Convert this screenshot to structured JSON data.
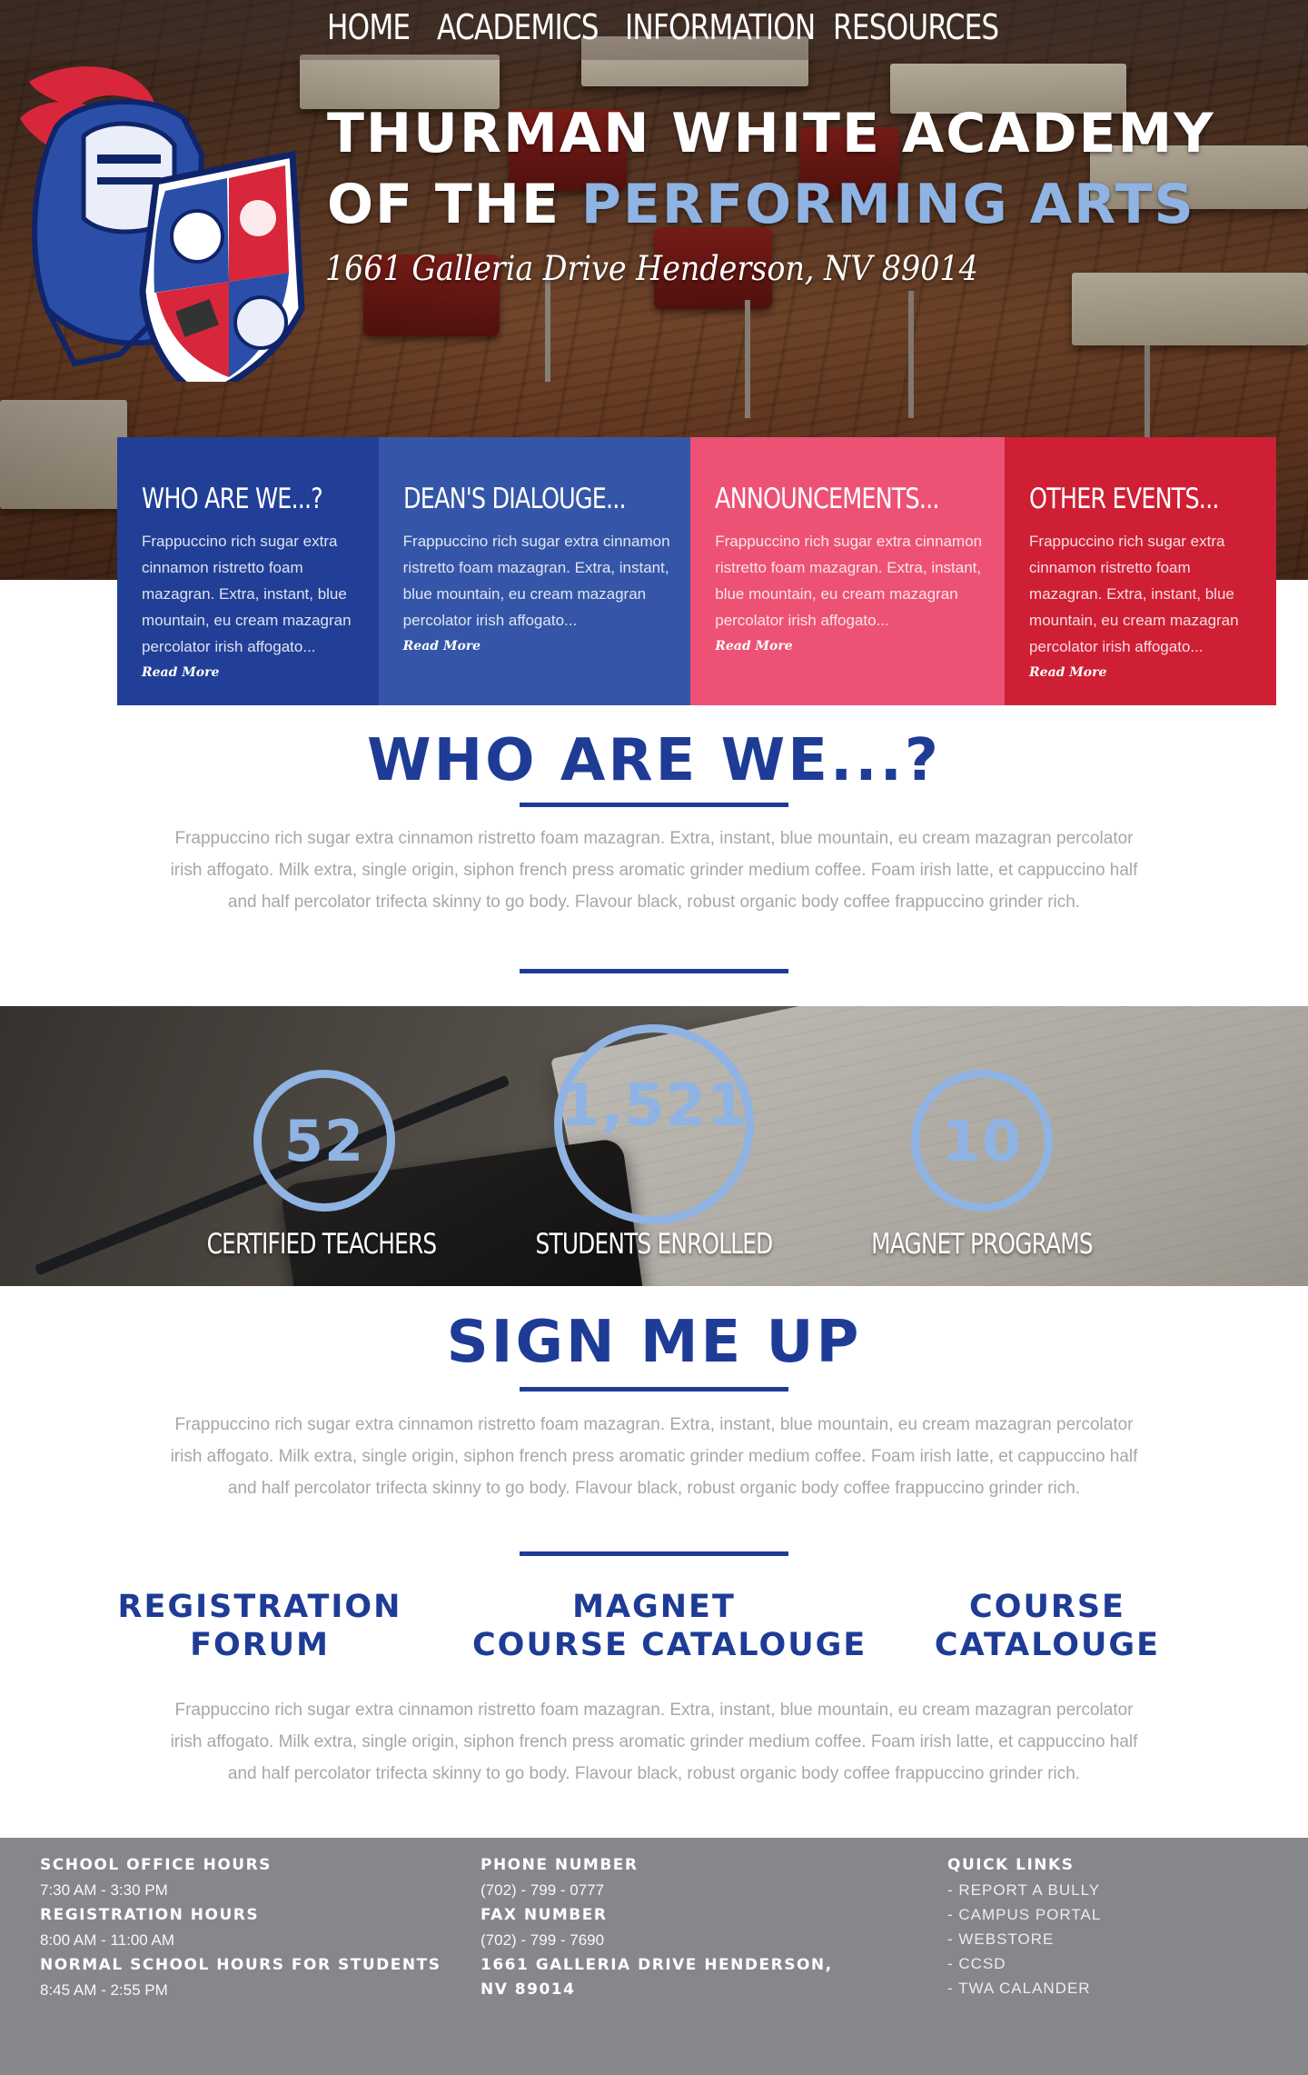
{
  "nav": {
    "items": [
      "HOME",
      "ACADEMICS",
      "INFORMATION",
      "RESOURCES"
    ]
  },
  "hero": {
    "title_line1": "THURMAN WHITE ACADEMY",
    "title_line2_prefix": "OF THE ",
    "title_line2_accent": "PERFORMING ARTS",
    "address": "1661 Galleria Drive  Henderson, NV 89014"
  },
  "features": [
    {
      "title": "WHO ARE WE...?",
      "text": "Frappuccino rich sugar extra cinnamon ristretto foam mazagran. Extra, instant, blue mountain, eu cream mazagran percolator irish affogato...",
      "more": "Read More",
      "color": "#213f97"
    },
    {
      "title": "DEAN'S DIALOUGE...",
      "text": "Frappuccino rich sugar extra cinnamon ristretto foam mazagran. Extra, instant, blue mountain, eu cream mazagran percolator irish affogato...",
      "more": "Read More",
      "color": "#3556a8"
    },
    {
      "title": "ANNOUNCEMENTS...",
      "text": "Frappuccino rich sugar extra cinnamon ristretto foam mazagran. Extra, instant, blue mountain, eu cream mazagran percolator irish affogato...",
      "more": "Read More",
      "color": "#ed5274"
    },
    {
      "title": "OTHER EVENTS...",
      "text": "Frappuccino rich sugar extra cinnamon ristretto foam mazagran. Extra, instant, blue mountain, eu cream mazagran percolator irish affogato...",
      "more": "Read More",
      "color": "#cf1f35"
    }
  ],
  "who": {
    "title": "WHO ARE WE...?",
    "text": "Frappuccino rich sugar extra cinnamon ristretto foam mazagran. Extra, instant, blue mountain, eu cream mazagran percolator irish affogato. Milk extra, single origin, siphon french press aromatic grinder medium coffee. Foam irish latte, et cappuccino half and half percolator trifecta skinny to go body. Flavour black, robust organic body coffee frappuccino grinder rich."
  },
  "stats": [
    {
      "number": "52",
      "label": "CERTIFIED TEACHERS"
    },
    {
      "number": "1,521",
      "label": "STUDENTS ENROLLED"
    },
    {
      "number": "10",
      "label": "MAGNET PROGRAMS"
    }
  ],
  "signup": {
    "title": "SIGN ME UP",
    "text": "Frappuccino rich sugar extra cinnamon ristretto foam mazagran. Extra, instant, blue mountain, eu cream mazagran percolator irish affogato. Milk extra, single origin, siphon french press aromatic grinder medium coffee. Foam irish latte, et cappuccino half and half percolator trifecta skinny to go body. Flavour black, robust organic body coffee frappuccino grinder rich.",
    "links": [
      {
        "line1": "REGISTRATION",
        "line2": "FORUM"
      },
      {
        "line1": "MAGNET",
        "line2": "COURSE CATALOUGE"
      },
      {
        "line1": "COURSE",
        "line2": "CATALOUGE"
      }
    ],
    "text2": "Frappuccino rich sugar extra cinnamon ristretto foam mazagran. Extra, instant, blue mountain, eu cream mazagran percolator irish affogato. Milk extra, single origin, siphon french press aromatic grinder medium coffee. Foam irish latte, et cappuccino half and half percolator trifecta skinny to go body. Flavour black, robust organic body coffee frappuccino grinder rich."
  },
  "footer": {
    "office_hours_head": "SCHOOL OFFICE HOURS",
    "office_hours": "7:30 AM - 3:30 PM",
    "registration_head": "REGISTRATION HOURS",
    "registration_hours": "8:00 AM - 11:00 AM",
    "school_hours_head": "NORMAL SCHOOL HOURS FOR STUDENTS",
    "school_hours": "8:45 AM - 2:55 PM",
    "phone_head": "PHONE NUMBER",
    "phone": "(702) - 799 - 0777",
    "fax_head": "FAX NUMBER",
    "fax": "(702) - 799 - 7690",
    "address_line1": "1661 GALLERIA DRIVE  HENDERSON,",
    "address_line2": "NV 89014",
    "quick_links_head": "QUICK LINKS",
    "quick_links": [
      "- REPORT A BULLY",
      "- CAMPUS PORTAL",
      "- WEBSTORE",
      "- CCSD",
      "- TWA CALANDER"
    ]
  },
  "colors": {
    "brand_blue": "#1e3c96",
    "light_blue": "#8fb3e3",
    "footer_gray": "#86878b",
    "body_gray": "#a7a7a7"
  }
}
